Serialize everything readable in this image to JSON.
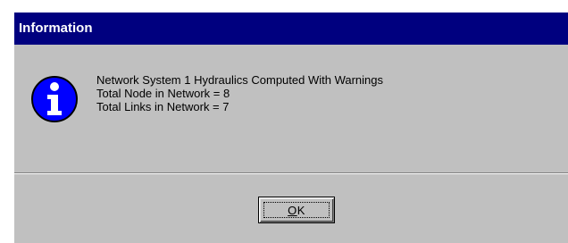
{
  "dialog": {
    "title": "Information",
    "icon": "information-icon",
    "message_lines": [
      "Network System 1 Hydraulics Computed With Warnings",
      "Total Node in Network = 8",
      "Total Links in Network = 7"
    ],
    "ok_label": "OK"
  },
  "colors": {
    "titlebar": "#00007f",
    "dialog_face": "#c0c0c0",
    "icon_blue": "#0000ff"
  }
}
